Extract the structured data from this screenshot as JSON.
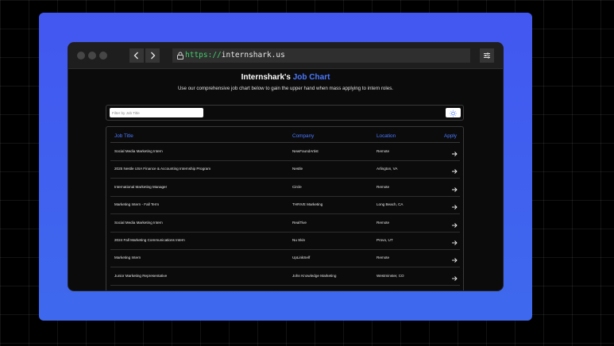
{
  "browser": {
    "url_scheme": "https://",
    "url_host": "internshark.us",
    "back_icon": "chevron-left-icon",
    "forward_icon": "chevron-right-icon",
    "lock_icon": "lock-icon",
    "settings_icon": "sliders-icon"
  },
  "page": {
    "title_prefix": "Internshark's",
    "title_highlight": "Job Chart",
    "subtitle": "Use our comprehensive job chart below to gain the upper hand when mass applying to intern roles.",
    "filter_placeholder": "Filter by Job Title",
    "theme_icon": "sun-icon"
  },
  "table": {
    "headers": {
      "title": "Job Title",
      "company": "Company",
      "location": "Location",
      "apply": "Apply"
    },
    "rows": [
      {
        "title": "Social Media Marketing Intern",
        "company": "NewFoundArtist",
        "location": "Remote"
      },
      {
        "title": "2025 Nestle USA Finance & Accounting Internship Program",
        "company": "Nestle",
        "location": "Arlington, VA"
      },
      {
        "title": "International Marketing Manager",
        "company": "Circle",
        "location": "Remote"
      },
      {
        "title": "Marketing Intern - Fall Term",
        "company": "THRIVE Marketing",
        "location": "Long Beach, CA"
      },
      {
        "title": "Social Media Marketing Intern",
        "company": "RealTive",
        "location": "Remote"
      },
      {
        "title": "2024 Fall Marketing Communications Intern",
        "company": "Nu Skin",
        "location": "Provo, UT"
      },
      {
        "title": "Marketing Intern",
        "company": "UpLinkSelf",
        "location": "Remote"
      },
      {
        "title": "Junior Marketing Representative",
        "company": "John Knowledge Marketing",
        "location": "Westminster, CO"
      }
    ]
  },
  "colors": {
    "accent": "#4b78ff",
    "panel": "#4257f0",
    "url_scheme": "#3fcf6a"
  }
}
